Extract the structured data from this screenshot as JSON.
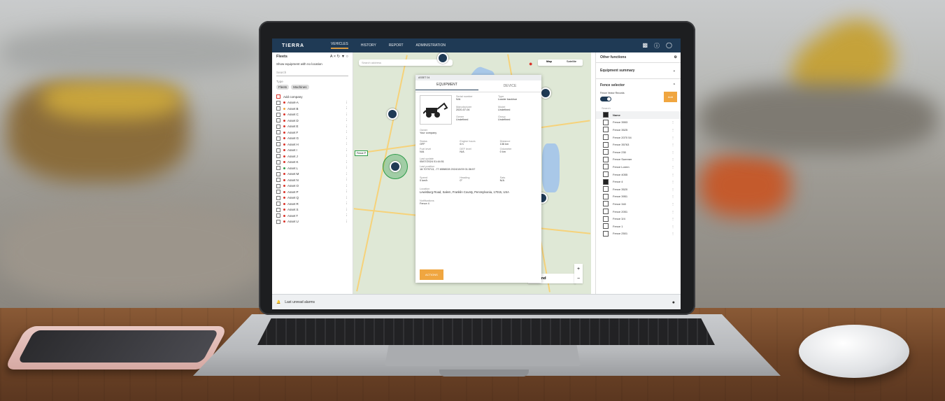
{
  "app": {
    "brand": "TIERRA",
    "nav": [
      "VEHICLES",
      "HISTORY",
      "REPORT",
      "ADMINISTRATION"
    ]
  },
  "left_panel": {
    "title": "Fleets",
    "show_equipment": "Show equipment with no location",
    "search_placeholder": "Search",
    "type_label": "Type",
    "chips": [
      "Fleets",
      "Machines"
    ],
    "select_all": "Select all",
    "group": "Add company",
    "assets": [
      "Asset-A",
      "Asset B",
      "Asset C",
      "Asset D",
      "Asset E",
      "Asset F",
      "Asset G",
      "Asset H",
      "Asset I",
      "Asset J",
      "Asset K",
      "Asset L",
      "Asset M",
      "Asset N",
      "Asset O",
      "Asset P",
      "Asset Q",
      "Asset R",
      "Asset S",
      "Asset T",
      "Asset U"
    ],
    "asset_colors": [
      "#d9342b",
      "#f0a640",
      "#d9342b",
      "#d9342b",
      "#d9342b",
      "#d9342b",
      "#d9342b",
      "#d9342b",
      "#d9342b",
      "#d9342b",
      "#d9342b",
      "#2e9c4a",
      "#d9342b",
      "#d9342b",
      "#d9342b",
      "#d9342b",
      "#d9342b",
      "#d9342b",
      "#d9342b",
      "#d9342b",
      "#d9342b"
    ]
  },
  "map": {
    "search_placeholder": "Search address",
    "map_tab": "Map",
    "satellite_tab": "Satellite",
    "legend": "Legend",
    "zoom_in": "+",
    "zoom_out": "−",
    "fence_label": "Fence P"
  },
  "card": {
    "header": "ASSET 04",
    "tab_equipment": "EQUIPMENT",
    "tab_device": "DEVICE",
    "fields": [
      [
        "Serial number",
        "N/A"
      ],
      [
        "Type",
        "Loader backhoe"
      ],
      [
        "Manufacturer",
        "2020-07-04"
      ],
      [
        "Model",
        "Undefined"
      ],
      [
        "Owner",
        "Undefined"
      ],
      [
        "Group",
        "Undefined"
      ]
    ],
    "company_label": "Owner",
    "company": "Your company",
    "metrics": [
      [
        "Status",
        "OFF"
      ],
      [
        "Engine hours",
        "6 h"
      ],
      [
        "Distance",
        "136 km"
      ],
      [
        "Fuel level",
        "N/A"
      ],
      [
        "DEF level",
        "N/A"
      ],
      [
        "Odometer",
        "0 km"
      ]
    ],
    "last_update_label": "Last update",
    "last_update": "05/07/2024 01:44:51",
    "last_fix_label": "Last position",
    "last_fix": "18.7079713, -77.6558028 2024/10/09 01:36:57",
    "speed_rows": [
      [
        "Speed",
        "0 km/h"
      ],
      [
        "Heading",
        "0°"
      ],
      [
        "Sats",
        "N/A"
      ]
    ],
    "location_label": "Location",
    "location": "Lewisburg Road, Salem, Franklin County, Pennsylvania, 17015, USA",
    "notifications_label": "Notifications",
    "notifications": "Fence 4",
    "action": "ACTIONS"
  },
  "right_panel": {
    "title": "Other functions",
    "equipment_summary": "Equipment summary",
    "fence_selector": "Fence selector",
    "fence_toggle_label": "Fence Vector Records",
    "add_button": "Add",
    "search_placeholder": "Search",
    "column": "Name",
    "fences": [
      "Fence 3553",
      "Fence 3525",
      "Fence 2070 54",
      "Fence 35763",
      "Fence 230",
      "Fence Summer",
      "Fence Lorem",
      "Fence 4055",
      "Fence 4",
      "Fence 3520",
      "Fence 3951",
      "Fence 340",
      "Fence 2051",
      "Fence 3/4",
      "Fence 1",
      "Fence 2501"
    ],
    "checked_index": 8
  },
  "footer": {
    "alarm_text": "Last unread alarms"
  },
  "colors": {
    "topbar": "#1f3a55",
    "accent": "#f0a640"
  }
}
